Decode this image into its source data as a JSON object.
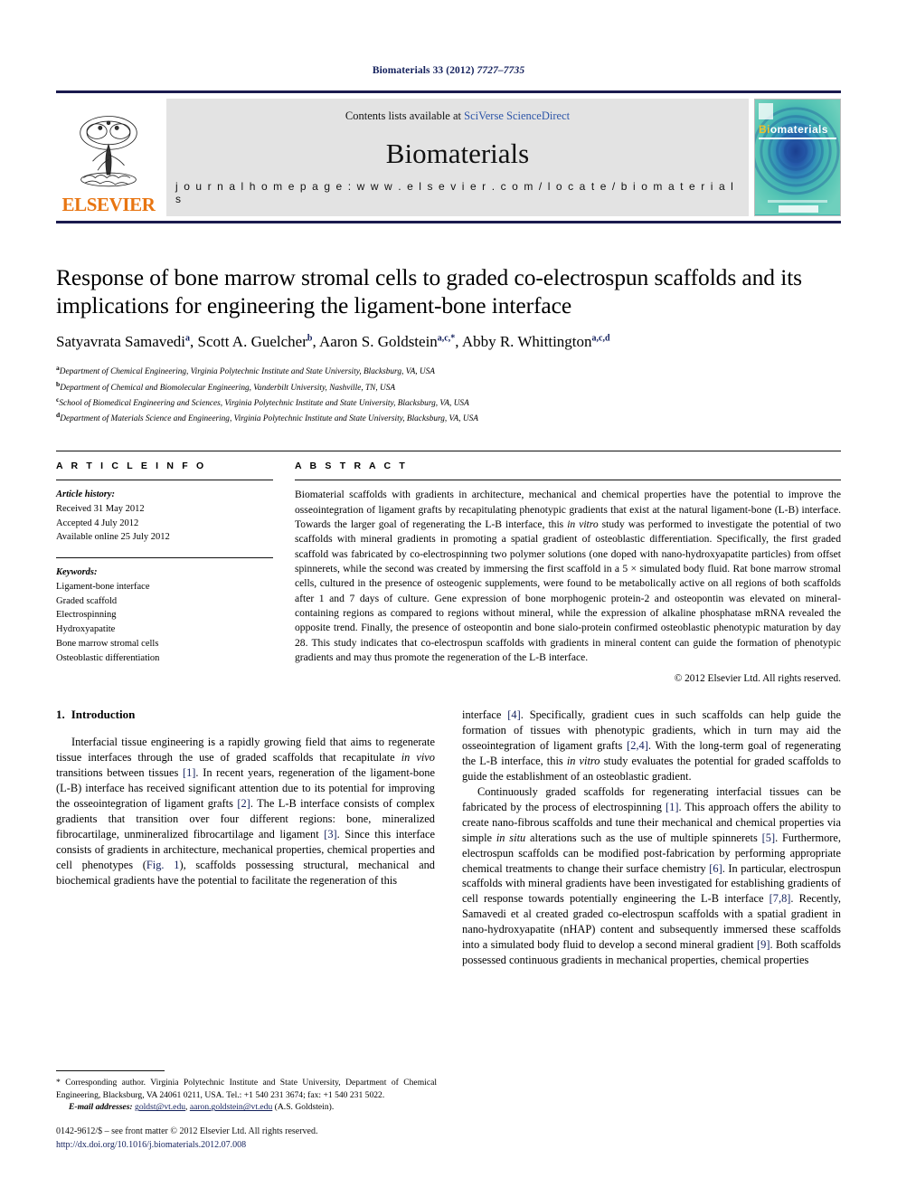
{
  "running_head": {
    "journal": "Biomaterials 33 (2012)",
    "pages": "7727–7735"
  },
  "masthead": {
    "publisher": "ELSEVIER",
    "contents_prefix": "Contents lists available at ",
    "contents_link": "SciVerse ScienceDirect",
    "journal_name": "Biomaterials",
    "homepage": "j o u r n a l   h o m e p a g e :   w w w . e l s e v i e r . c o m / l o c a t e / b i o m a t e r i a l s",
    "cover": {
      "bi": "Bi",
      "rest": "omaterials"
    }
  },
  "article": {
    "title": "Response of bone marrow stromal cells to graded co-electrospun scaffolds and its implications for engineering the ligament-bone interface",
    "authors": [
      {
        "name": "Satyavrata Samavedi",
        "marks": "a"
      },
      {
        "name": "Scott A. Guelcher",
        "marks": "b"
      },
      {
        "name": "Aaron S. Goldstein",
        "marks": "a,c,*"
      },
      {
        "name": "Abby R. Whittington",
        "marks": "a,c,d"
      }
    ],
    "affiliations": [
      {
        "mark": "a",
        "text": "Department of Chemical Engineering, Virginia Polytechnic Institute and State University, Blacksburg, VA, USA"
      },
      {
        "mark": "b",
        "text": "Department of Chemical and Biomolecular Engineering, Vanderbilt University, Nashville, TN, USA"
      },
      {
        "mark": "c",
        "text": "School of Biomedical Engineering and Sciences, Virginia Polytechnic Institute and State University, Blacksburg, VA, USA"
      },
      {
        "mark": "d",
        "text": "Department of Materials Science and Engineering, Virginia Polytechnic Institute and State University, Blacksburg, VA, USA"
      }
    ]
  },
  "article_info": {
    "heading": "A R T I C L E   I N F O",
    "history_label": "Article history:",
    "history": [
      "Received 31 May 2012",
      "Accepted 4 July 2012",
      "Available online 25 July 2012"
    ],
    "keywords_label": "Keywords:",
    "keywords": [
      "Ligament-bone interface",
      "Graded scaffold",
      "Electrospinning",
      "Hydroxyapatite",
      "Bone marrow stromal cells",
      "Osteoblastic differentiation"
    ]
  },
  "abstract": {
    "heading": "A B S T R A C T",
    "part1": "Biomaterial scaffolds with gradients in architecture, mechanical and chemical properties have the potential to improve the osseointegration of ligament grafts by recapitulating phenotypic gradients that exist at the natural ligament-bone (L-B) interface. Towards the larger goal of regenerating the L-B interface, this ",
    "italic1": "in vitro",
    "part2": " study was performed to investigate the potential of two scaffolds with mineral gradients in promoting a spatial gradient of osteoblastic differentiation. Specifically, the first graded scaffold was fabricated by co-electrospinning two polymer solutions (one doped with nano-hydroxyapatite particles) from offset spinnerets, while the second was created by immersing the first scaffold in a 5 × simulated body fluid. Rat bone marrow stromal cells, cultured in the presence of osteogenic supplements, were found to be metabolically active on all regions of both scaffolds after 1 and 7 days of culture. Gene expression of bone morphogenic protein-2 and osteopontin was elevated on mineral-containing regions as compared to regions without mineral, while the expression of alkaline phosphatase mRNA revealed the opposite trend. Finally, the presence of osteopontin and bone sialo-protein confirmed osteoblastic phenotypic maturation by day 28. This study indicates that co-electrospun scaffolds with gradients in mineral content can guide the formation of phenotypic gradients and may thus promote the regeneration of the L-B interface.",
    "copyright": "© 2012 Elsevier Ltd. All rights reserved."
  },
  "introduction": {
    "number": "1.",
    "title": "Introduction",
    "left_p1_a": "Interfacial tissue engineering is a rapidly growing field that aims to regenerate tissue interfaces through the use of graded scaffolds that recapitulate ",
    "left_p1_italic": "in vivo",
    "left_p1_b": " transitions between tissues ",
    "left_p1_ref1": "[1]",
    "left_p1_c": ". In recent years, regeneration of the ligament-bone (L-B) interface has received significant attention due to its potential for improving the osseointegration of ligament grafts ",
    "left_p1_ref2": "[2]",
    "left_p1_d": ". The L-B interface consists of complex gradients that transition over four different regions: bone, mineralized fibrocartilage, unmineralized fibrocartilage and ligament ",
    "left_p1_ref3": "[3]",
    "left_p1_e": ". Since this interface consists of gradients in architecture, mechanical properties, chemical properties and cell phenotypes (",
    "left_p1_figref": "Fig. 1",
    "left_p1_f": "), scaffolds possessing structural, mechanical and biochemical gradients have the potential to facilitate the regeneration of this",
    "right_p1_a": "interface ",
    "right_p1_ref4": "[4]",
    "right_p1_b": ". Specifically, gradient cues in such scaffolds can help guide the formation of tissues with phenotypic gradients, which in turn may aid the osseointegration of ligament grafts ",
    "right_p1_ref24": "[2,4]",
    "right_p1_c": ". With the long-term goal of regenerating the L-B interface, this ",
    "right_p1_italic": "in vitro",
    "right_p1_d": " study evaluates the potential for graded scaffolds to guide the establishment of an osteoblastic gradient.",
    "right_p2_a": "Continuously graded scaffolds for regenerating interfacial tissues can be fabricated by the process of electrospinning ",
    "right_p2_ref1": "[1]",
    "right_p2_b": ". This approach offers the ability to create nano-fibrous scaffolds and tune their mechanical and chemical properties via simple ",
    "right_p2_italic1": "in situ",
    "right_p2_c": " alterations such as the use of multiple spinnerets ",
    "right_p2_ref5": "[5]",
    "right_p2_d": ". Furthermore, electrospun scaffolds can be modified post-fabrication by performing appropriate chemical treatments to change their surface chemistry ",
    "right_p2_ref6": "[6]",
    "right_p2_e": ". In particular, electrospun scaffolds with mineral gradients have been investigated for establishing gradients of cell response towards potentially engineering the L-B interface ",
    "right_p2_ref78": "[7,8]",
    "right_p2_f": ". Recently, Samavedi et al created graded co-electrospun scaffolds with a spatial gradient in nano-hydroxyapatite (nHAP) content and subsequently immersed these scaffolds into a simulated body fluid to develop a second mineral gradient ",
    "right_p2_ref9": "[9]",
    "right_p2_g": ". Both scaffolds possessed continuous gradients in mechanical properties, chemical properties"
  },
  "footnotes": {
    "corresponding": "* Corresponding author. Virginia Polytechnic Institute and State University, Department of Chemical Engineering, Blacksburg, VA 24061 0211, USA. Tel.: +1 540 231 3674; fax: +1 540 231 5022.",
    "email_label": "E-mail addresses:",
    "email1": "goldst@vt.edu",
    "email2": "aaron.goldstein@vt.edu",
    "email_tail": " (A.S. Goldstein)."
  },
  "imprint": {
    "line1": "0142-9612/$ – see front matter © 2012 Elsevier Ltd. All rights reserved.",
    "doi": "http://dx.doi.org/10.1016/j.biomaterials.2012.07.008"
  },
  "colors": {
    "link": "#2d55a8",
    "ref": "#13205c",
    "elsevier_orange": "#e87511",
    "cover_teal": "#3fb8b0"
  }
}
